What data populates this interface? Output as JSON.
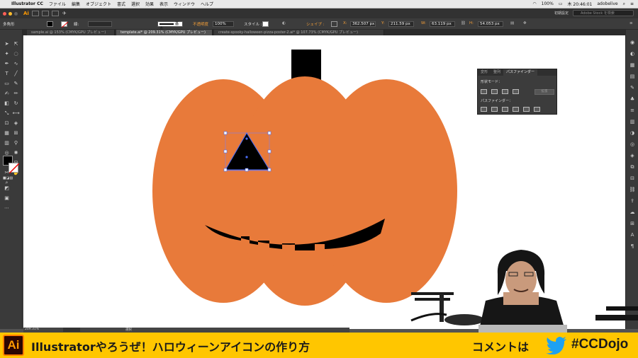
{
  "menubar": {
    "app_name": "Illustrator CC",
    "items": [
      "ファイル",
      "編集",
      "オブジェクト",
      "書式",
      "選択",
      "効果",
      "表示",
      "ウィンドウ",
      "ヘルプ"
    ],
    "battery": "100%",
    "clock": "木 20:46:01",
    "user": "adobelive"
  },
  "appbar": {
    "logo": "Ai",
    "workspace": "初期設定",
    "stock_search_placeholder": "Adobe Stock を検索"
  },
  "control_bar": {
    "selection_label": "多角形",
    "stroke_label": "線:",
    "profile_label": "基本",
    "opacity_label": "不透明度",
    "opacity_value": "100%",
    "style_label": "スタイル :",
    "shape_label": "シェイプ :",
    "x_label": "X:",
    "x_value": "362.507 px",
    "y_label": "Y:",
    "y_value": "211.59 px",
    "w_label": "W:",
    "w_value": "63.119 px",
    "h_label": "H:",
    "h_value": "54.053 px"
  },
  "tabs": [
    {
      "label": "sample.ai @ 153% (CMYK/GPU プレビュー)",
      "active": false
    },
    {
      "label": "template.ai* @ 209.31% (CMYK/GPU プレビュー)",
      "active": true
    },
    {
      "label": "create-spooky-halloween-pizza-poster-2.ai* @ 107.73% (CMYK/GPU プレビュー)",
      "active": false
    }
  ],
  "pathfinder_panel": {
    "tabs": [
      "変形",
      "整列",
      "パスファインダー"
    ],
    "shape_modes_label": "形状モード：",
    "expand_button": "拡張",
    "pathfinders_label": "パスファインダー："
  },
  "status": {
    "zoom": "209.31%",
    "mode": "選択"
  },
  "banner": {
    "logo": "Ai",
    "title": "Illustratorやろうぜ！ハロウィーンアイコンの作り方",
    "comment_label": "コメントは",
    "hashtag": "#CCDojo"
  },
  "colors": {
    "pumpkin": "#e87a3a",
    "stem": "#000000",
    "banner": "#ffc600",
    "selection": "#4a6cf7",
    "ai_orange": "#ff9a00",
    "twitter": "#1da1f2"
  }
}
